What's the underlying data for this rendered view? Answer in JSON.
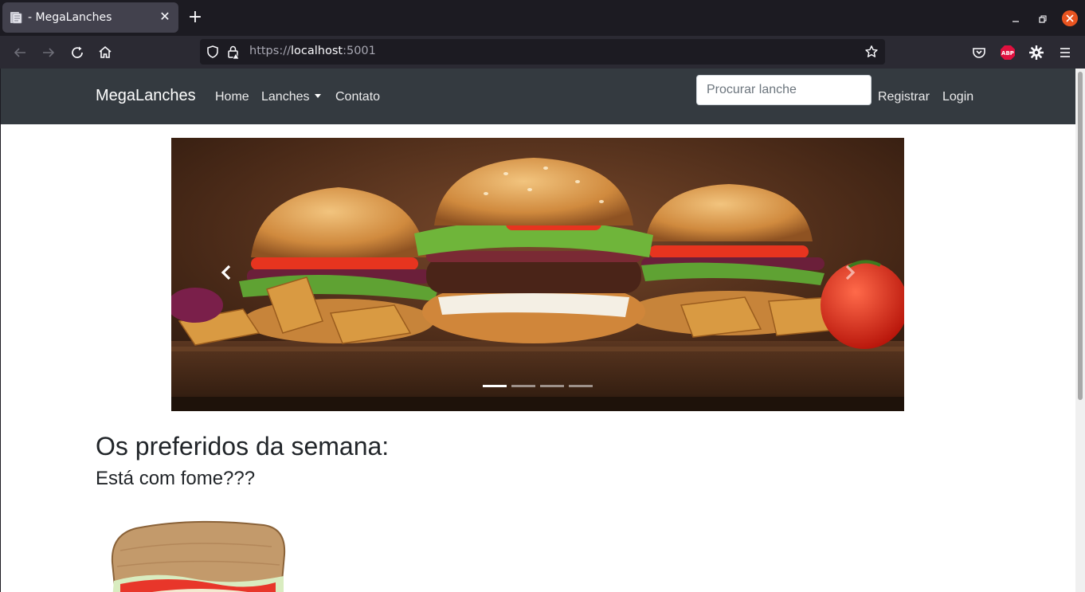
{
  "browser": {
    "tab_title": "- MegaLanches",
    "new_tab_label": "+",
    "url_scheme": "https://",
    "url_host": "localhost",
    "url_port": ":5001",
    "accent_close": "#e95420"
  },
  "site": {
    "brand": "MegaLanches",
    "nav": {
      "home": "Home",
      "lanches": "Lanches",
      "contato": "Contato"
    },
    "search_placeholder": "Procurar lanche",
    "registrar": "Registrar",
    "login": "Login",
    "navbar_color": "#343a40"
  },
  "carousel": {
    "slide_count": 4,
    "active_index": 0,
    "image": "burgers-on-wooden-board"
  },
  "content": {
    "title": "Os preferidos da semana:",
    "subtitle": "Está com fome???",
    "first_item_image": "sandwich"
  }
}
